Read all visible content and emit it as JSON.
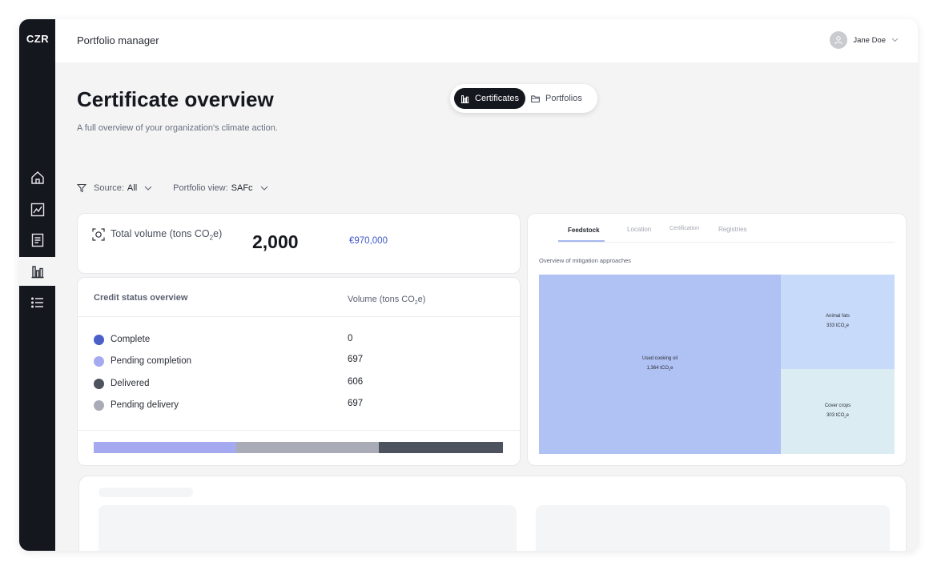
{
  "sidebar": {
    "logo": "CZR",
    "items": [
      {
        "name": "home",
        "icon": "home-icon"
      },
      {
        "name": "trends",
        "icon": "line-chart-icon"
      },
      {
        "name": "reports",
        "icon": "document-icon"
      },
      {
        "name": "certificates",
        "icon": "bar-chart-icon",
        "active": true
      },
      {
        "name": "list",
        "icon": "list-icon"
      }
    ]
  },
  "topbar": {
    "title": "Portfolio manager",
    "user_name": "Jane Doe"
  },
  "page": {
    "title": "Certificate overview",
    "subtitle": "A full overview of your organization's climate action."
  },
  "view_toggle": {
    "certificates": "Certificates",
    "portfolios": "Portfolios",
    "active": "certificates"
  },
  "filters": {
    "source_label": "Source:",
    "source_value": "All",
    "portfolio_label": "Portfolio view:",
    "portfolio_value": "SAFc"
  },
  "total_volume": {
    "label_pre": "Total volume (tons CO",
    "label_sub": "2",
    "label_post": "e)",
    "value": "2,000",
    "euro": "€970,000"
  },
  "credit_status": {
    "title": "Credit status overview",
    "column_pre": "Volume (tons CO",
    "column_sub": "2",
    "column_post": "e)",
    "rows": [
      {
        "label": "Complete",
        "value": "0",
        "color": "#4a5fc7"
      },
      {
        "label": "Pending completion",
        "value": "697",
        "color": "#a5a9f0"
      },
      {
        "label": "Delivered",
        "value": "606",
        "color": "#4c525e"
      },
      {
        "label": "Pending delivery",
        "value": "697",
        "color": "#a9acb6"
      }
    ],
    "bar": [
      {
        "status": "Pending completion",
        "share": 0.348,
        "color": "#a5a9f0"
      },
      {
        "status": "Pending delivery",
        "share": 0.348,
        "color": "#a9acb6"
      },
      {
        "status": "Delivered",
        "share": 0.303,
        "color": "#4c525e"
      }
    ]
  },
  "mitigation": {
    "tabs": [
      "Feedstock",
      "Location",
      "Certification",
      "Registries"
    ],
    "active_tab": "Feedstock",
    "title": "Overview of mitigation approaches",
    "unit_pre": "tCO",
    "unit_sub": "2",
    "unit_post": "e",
    "tiles": [
      {
        "label": "Used cooking oil",
        "value": "1,364",
        "color": "#b0c1f4"
      },
      {
        "label": "Animal fats",
        "value": "333",
        "color": "#c7daf9"
      },
      {
        "label": "Cover crops",
        "value": "303",
        "color": "#dbecf3"
      }
    ]
  }
}
